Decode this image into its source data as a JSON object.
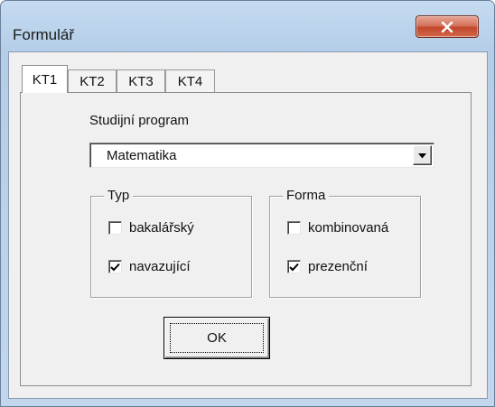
{
  "window": {
    "title": "Formulář"
  },
  "titlebar": {
    "close_icon": "close-x-icon"
  },
  "tabs": [
    {
      "label": "KT1",
      "active": true
    },
    {
      "label": "KT2",
      "active": false
    },
    {
      "label": "KT3",
      "active": false
    },
    {
      "label": "KT4",
      "active": false
    }
  ],
  "form": {
    "program_label": "Studijní program",
    "program_select": {
      "value": "Matematika",
      "arrow_icon": "dropdown-arrow-icon"
    },
    "typ": {
      "title": "Typ",
      "options": [
        {
          "label": "bakalářský",
          "checked": false
        },
        {
          "label": "navazující",
          "checked": true
        }
      ]
    },
    "forma": {
      "title": "Forma",
      "options": [
        {
          "label": "kombinovaná",
          "checked": false
        },
        {
          "label": "prezenční",
          "checked": true
        }
      ]
    },
    "ok_label": "OK"
  },
  "colors": {
    "title_bar": "#b9d1ea",
    "close_button": "#c3462b",
    "dialog_face": "#f0f0f0"
  }
}
